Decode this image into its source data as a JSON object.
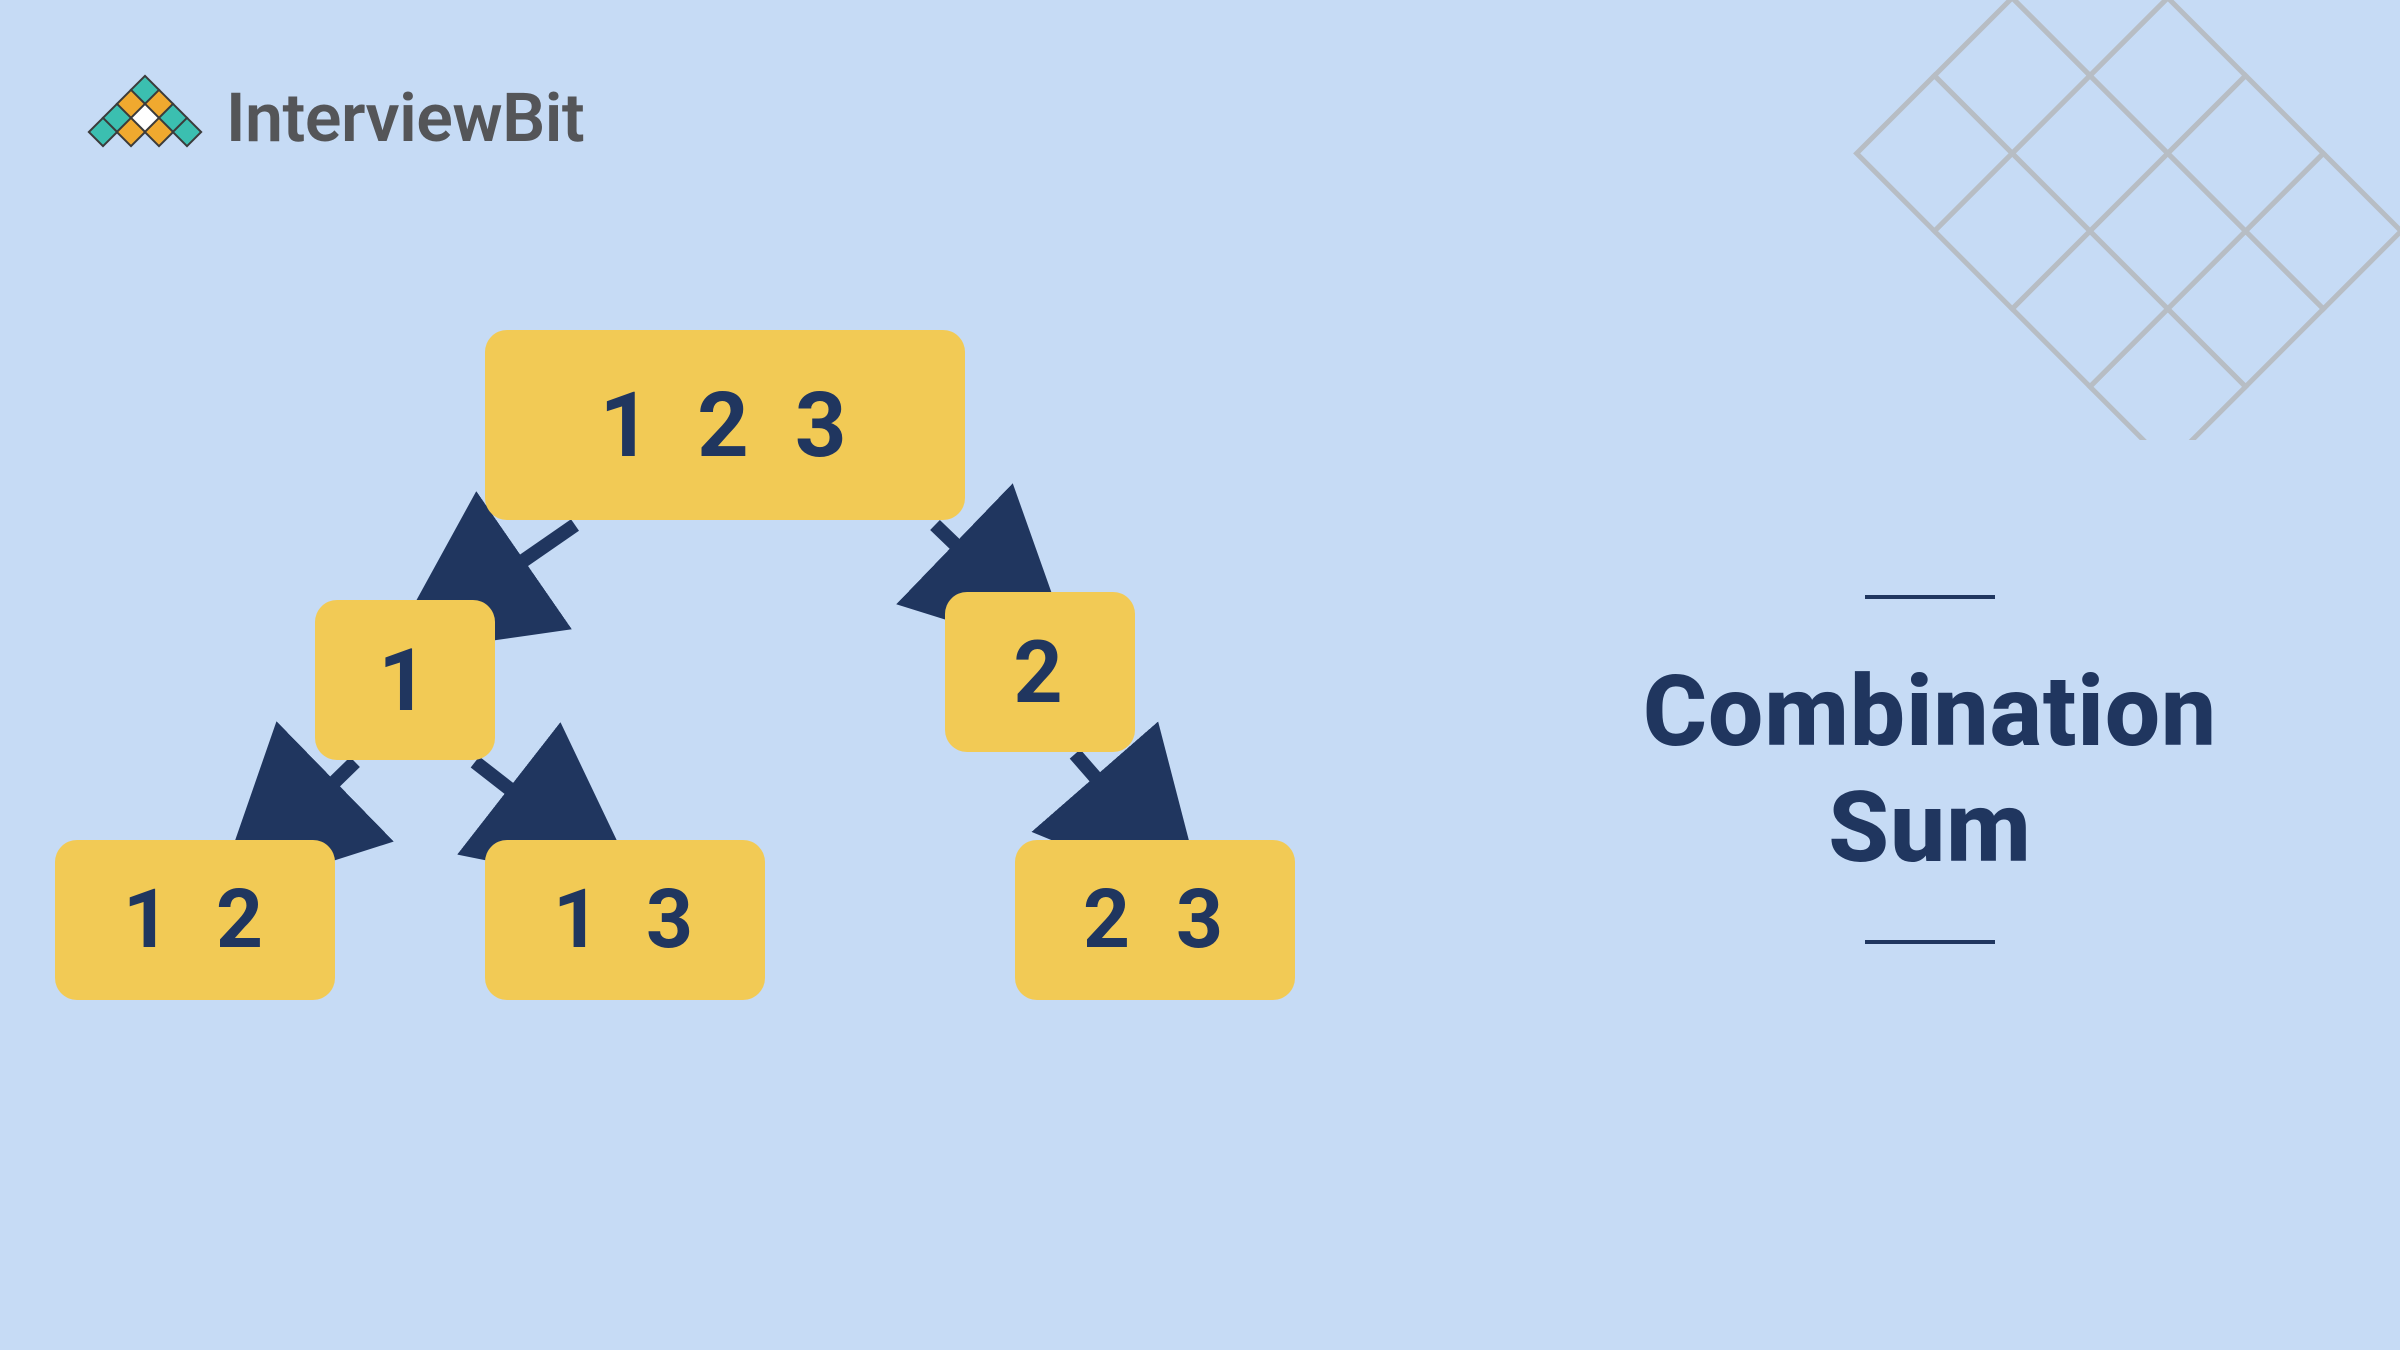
{
  "brand": {
    "name": "InterviewBit",
    "logo_colors": {
      "teal": "#3bbfb0",
      "orange": "#f0a92f",
      "outline": "#3b3b3b"
    }
  },
  "title": {
    "line1": "Combination",
    "line2": "Sum"
  },
  "tree": {
    "root": [
      "1",
      "2",
      "3"
    ],
    "n1": [
      "1"
    ],
    "n2": [
      "2"
    ],
    "n12": [
      "1",
      "2"
    ],
    "n13": [
      "1",
      "3"
    ],
    "n23": [
      "2",
      "3"
    ]
  },
  "colors": {
    "background": "#c6dbf5",
    "node_fill": "#f2ca55",
    "ink": "#20365f",
    "lattice": "#b7bdc4"
  }
}
